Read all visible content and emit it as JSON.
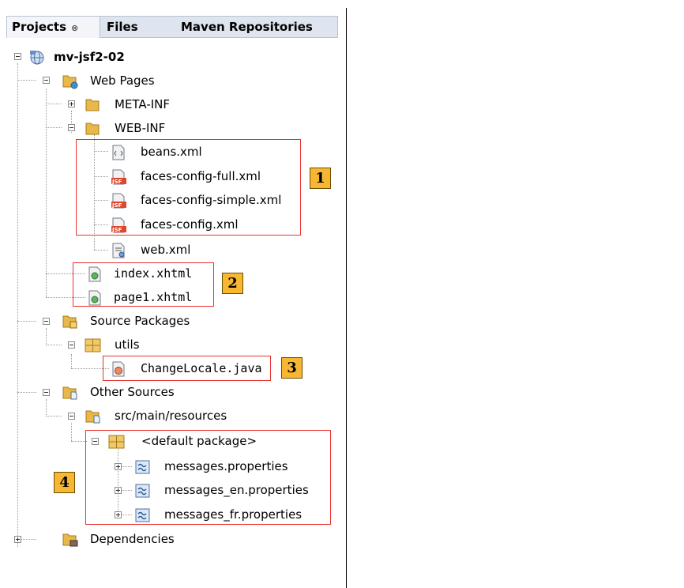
{
  "tabs": [
    {
      "label": "Projects",
      "close": "⊗",
      "active": true
    },
    {
      "label": "Files",
      "active": false
    },
    {
      "label": "Maven Repositories",
      "active": false
    }
  ],
  "tree": {
    "root": "mv-jsf2-02",
    "web_pages": "Web Pages",
    "meta_inf": "META-INF",
    "web_inf": "WEB-INF",
    "beans": "beans.xml",
    "faces_full": "faces-config-full.xml",
    "faces_simple": "faces-config-simple.xml",
    "faces": "faces-config.xml",
    "web_xml": "web.xml",
    "index": "index.xhtml",
    "page1": "page1.xhtml",
    "source_packages": "Source Packages",
    "utils": "utils",
    "change_locale": "ChangeLocale.java",
    "other_sources": "Other Sources",
    "resources": "src/main/resources",
    "default_pkg": "<default package>",
    "msg": "messages.properties",
    "msg_en": "messages_en.properties",
    "msg_fr": "messages_fr.properties",
    "dependencies": "Dependencies"
  },
  "badges": [
    "1",
    "2",
    "3",
    "4"
  ],
  "colors": {
    "highlight_box": "#e8312f",
    "badge_fill": "#f7b733",
    "folder": "#e8b84a",
    "package": "#e6b34a"
  }
}
